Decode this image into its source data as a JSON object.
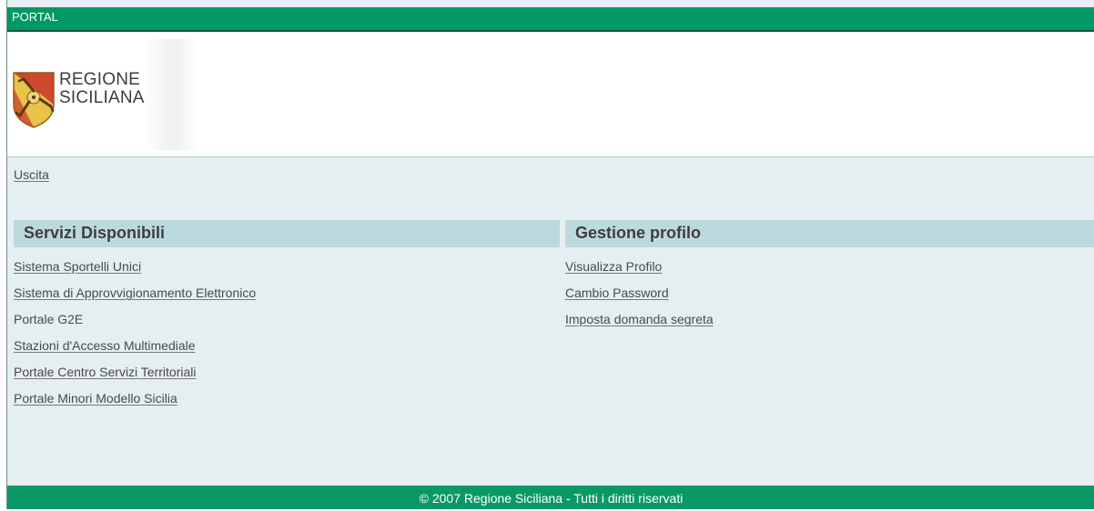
{
  "header": {
    "portal_label": "PORTAL"
  },
  "logo": {
    "line1": "REGIONE",
    "line2": "SICILIANA"
  },
  "nav": {
    "exit_link": "Uscita"
  },
  "services": {
    "title": "Servizi Disponibili",
    "items": [
      {
        "label": "Sistema Sportelli Unici",
        "link": true
      },
      {
        "label": "Sistema di Approvvigionamento Elettronico",
        "link": true
      },
      {
        "label": "Portale G2E",
        "link": false
      },
      {
        "label": "Stazioni d'Accesso Multimediale",
        "link": true
      },
      {
        "label": "Portale Centro Servizi Territoriali",
        "link": true
      },
      {
        "label": "Portale Minori Modello Sicilia",
        "link": true
      }
    ]
  },
  "profile": {
    "title": "Gestione profilo",
    "items": [
      {
        "label": "Visualizza Profilo"
      },
      {
        "label": "Cambio Password"
      },
      {
        "label": "Imposta domanda segreta"
      }
    ]
  },
  "footer": {
    "copyright": "© 2007 Regione Siciliana - Tutti i diritti riservati"
  },
  "colors": {
    "brand_green": "#009966",
    "section_header_bg": "#bcd9de",
    "content_bg": "#e5eef0"
  },
  "icons": {
    "crest": "trinacria-crest-icon"
  }
}
